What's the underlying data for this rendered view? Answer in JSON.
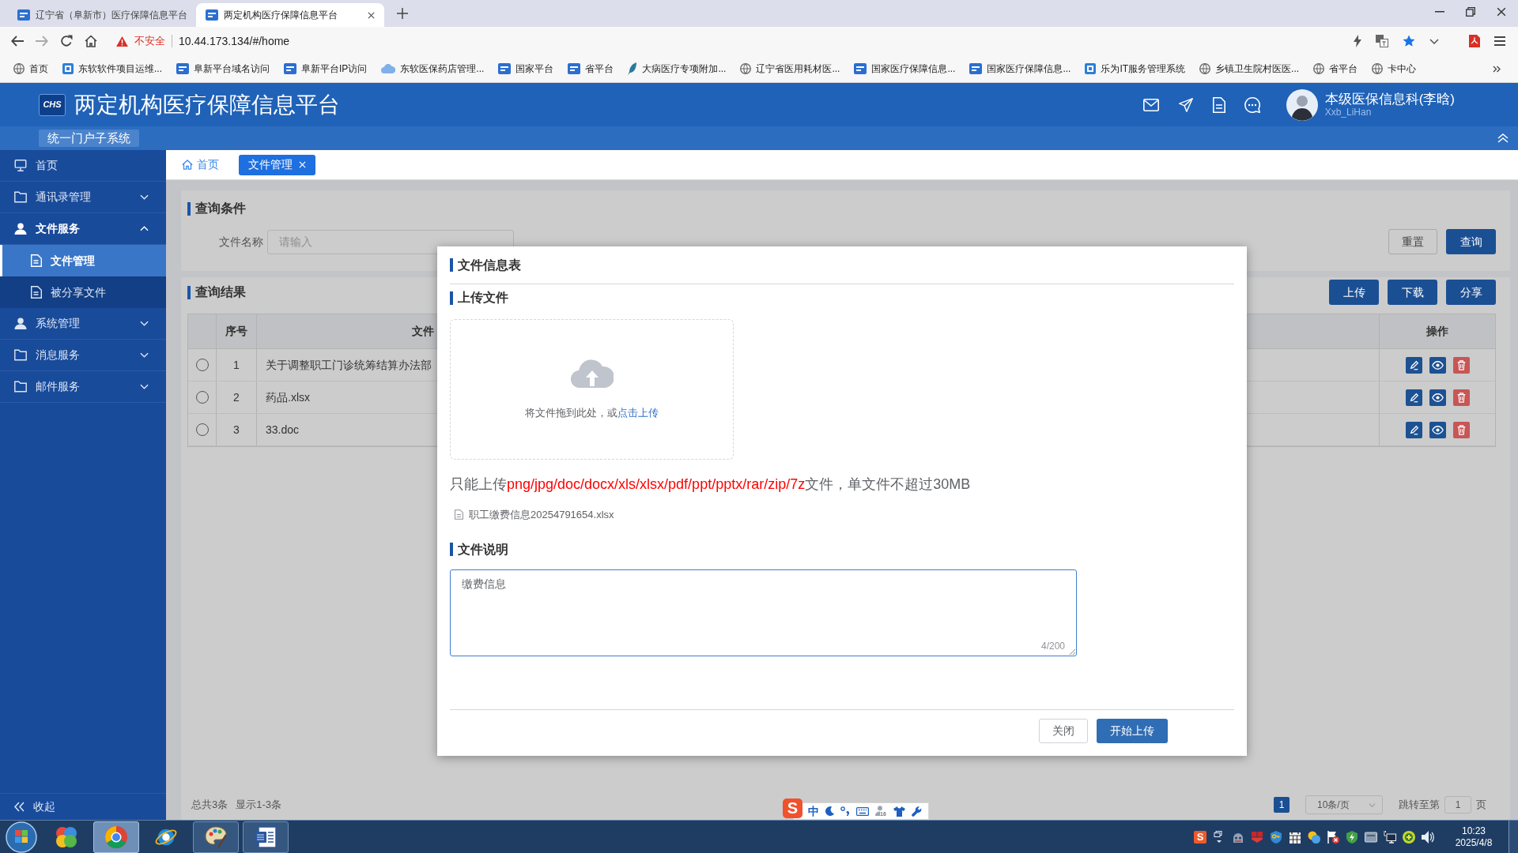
{
  "browser": {
    "tabs": [
      {
        "title": "辽宁省（阜新市）医疗保障信息平台",
        "selected": false
      },
      {
        "title": "两定机构医疗保障信息平台",
        "selected": true
      }
    ],
    "security_label": "不安全",
    "url": "10.44.173.134/#/home",
    "bookmarks": [
      "首页",
      "东软软件项目运维...",
      "阜新平台域名访问",
      "阜新平台IP访问",
      "东软医保药店管理...",
      "国家平台",
      "省平台",
      "大病医疗专项附加...",
      "辽宁省医用耗材医...",
      "国家医疗保障信息...",
      "国家医疗保障信息...",
      "乐为IT服务管理系统",
      "乡镇卫生院村医医...",
      "省平台",
      "卡中心"
    ]
  },
  "header": {
    "logo_text": "CHS",
    "title": "两定机构医疗保障信息平台",
    "user_name": "本级医保信息科(李晗)",
    "user_account": "Xxb_LiHan",
    "subsystem": "统一门户子系统"
  },
  "sidebar": {
    "items": [
      {
        "label": "首页",
        "selected": false
      },
      {
        "label": "通讯录管理",
        "selected": false,
        "expanded": false
      },
      {
        "label": "文件服务",
        "selected": false,
        "expanded": true,
        "children": [
          {
            "label": "文件管理",
            "selected": true
          },
          {
            "label": "被分享文件",
            "selected": false
          }
        ]
      },
      {
        "label": "系统管理",
        "selected": false,
        "expanded": false
      },
      {
        "label": "消息服务",
        "selected": false,
        "expanded": false
      },
      {
        "label": "邮件服务",
        "selected": false,
        "expanded": false
      }
    ],
    "collapse_label": "收起"
  },
  "content_tabs": [
    {
      "label": "首页",
      "selected": false,
      "closable": false
    },
    {
      "label": "文件管理",
      "selected": true,
      "closable": true
    }
  ],
  "query": {
    "title": "查询条件",
    "field": {
      "label": "文件名称",
      "placeholder": "请输入"
    },
    "buttons": [
      {
        "label": "重置",
        "kind": "default"
      },
      {
        "label": "查询",
        "kind": "primary"
      }
    ]
  },
  "results": {
    "title": "查询结果",
    "buttons": [
      {
        "label": "上传"
      },
      {
        "label": "下载"
      },
      {
        "label": "分享"
      }
    ],
    "table": {
      "columns": [
        "序号",
        "文件",
        "操作"
      ],
      "rows": [
        {
          "selected": false,
          "cells": [
            "1",
            "关于调整职工门诊统筹结算办法部"
          ]
        },
        {
          "selected": false,
          "cells": [
            "2",
            "药品.xlsx"
          ]
        },
        {
          "selected": false,
          "cells": [
            "3",
            "33.doc"
          ]
        }
      ]
    },
    "pagination": {
      "total": "总共3条",
      "range": "显示1-3条",
      "pages": [
        {
          "label": "1",
          "selected": true
        }
      ],
      "page_size": "10条/页",
      "jump_label": "跳转至第",
      "jump_value": "1",
      "jump_suffix": "页"
    }
  },
  "dialog": {
    "title": "文件信息表",
    "upload_heading": "上传文件",
    "drop_text": "将文件拖到此处，或",
    "drop_link": "点击上传",
    "tip": {
      "prefix": "只能上传",
      "types": "png/jpg/doc/docx/xls/xlsx/pdf/ppt/pptx/rar/zip/7z",
      "suffix": "文件，单文件不超过30MB"
    },
    "files": [
      "职工缴费信息20254791654.xlsx"
    ],
    "description_heading": "文件说明",
    "description": {
      "value": "缴费信息",
      "count": "4/200"
    },
    "buttons": [
      {
        "label": "关闭",
        "kind": "default"
      },
      {
        "label": "开始上传",
        "kind": "primary"
      }
    ]
  },
  "ime_toolbar": {
    "logo_text": "S",
    "mode": "中",
    "skin_badge": "16"
  },
  "taskbar": {
    "apps": [
      {
        "running": false,
        "selected": false
      },
      {
        "running": true,
        "selected": true
      },
      {
        "running": false,
        "selected": false
      },
      {
        "running": true,
        "selected": false
      },
      {
        "running": true,
        "selected": false
      }
    ],
    "ime_indicator": "S",
    "time": "10:23",
    "date": "2025/4/8"
  }
}
